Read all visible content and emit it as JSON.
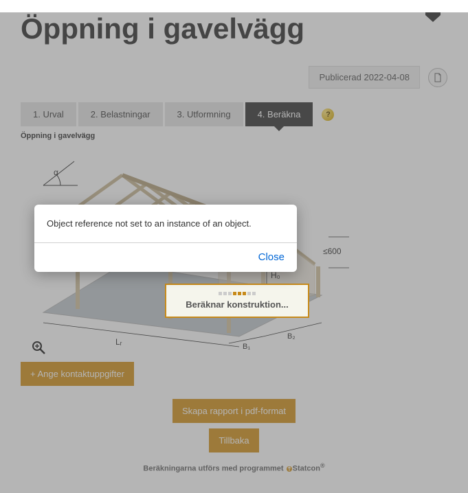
{
  "page": {
    "title": "Öppning i gavelvägg",
    "published_label": "Publicerad 2022-04-08"
  },
  "tabs": {
    "t1": "1. Urval",
    "t2": "2. Belastningar",
    "t3": "3. Utformning",
    "t4": "4. Beräkna"
  },
  "diagram": {
    "caption": "Öppning i gavelvägg",
    "alpha": "α",
    "constraint": "≤600",
    "h0": "H₀",
    "lr": "Lᵣ",
    "b1": "B₁",
    "b2": "B₂"
  },
  "calculating": {
    "text": "Beräknar konstruktion..."
  },
  "buttons": {
    "contact": "+ Ange kontaktuppgifter",
    "report": "Skapa rapport i pdf-format",
    "back": "Tillbaka"
  },
  "footer": {
    "text": "Beräkningarna utförs med programmet",
    "product": "Statcon"
  },
  "modal": {
    "message": "Object reference not set to an instance of an object.",
    "close": "Close"
  }
}
